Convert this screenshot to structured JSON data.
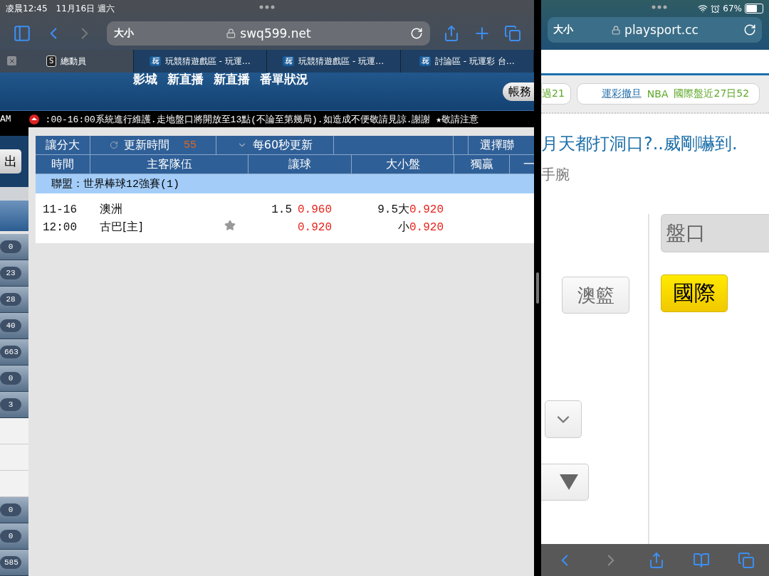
{
  "left_window": {
    "status_bar": {
      "time": "凌晨12:45",
      "date": "11月16日 週六"
    },
    "address_bar": {
      "text_size": "大小",
      "url": "swq599.net"
    },
    "tabs": [
      {
        "label": "總動員",
        "badge": "S",
        "selected": true
      },
      {
        "label": "玩競猜遊戲區 - 玩運…",
        "badge": "玩",
        "selected": false
      },
      {
        "label": "玩競猜遊戲區 - 玩運…",
        "badge": "玩",
        "selected": false
      },
      {
        "label": "討論區 - 玩運彩 台…",
        "badge": "玩",
        "selected": false
      }
    ],
    "site": {
      "nav": [
        "影城",
        "新直播",
        "新直播",
        "番單狀況"
      ],
      "account_button": "帳務",
      "ticker_prefix": "AM",
      "ticker": ":00-16:00系統進行維護.走地盤口將開放至13點(不論至第幾局).如造成不便敬請見諒.謝謝  ★敬請注意",
      "exit_button": "出",
      "sidebar": [
        {
          "kind": "badge",
          "count": "0"
        },
        {
          "kind": "badge",
          "count": "23"
        },
        {
          "kind": "badge",
          "count": "28"
        },
        {
          "kind": "badge",
          "count": "40"
        },
        {
          "kind": "badge",
          "count": "663"
        },
        {
          "kind": "badge",
          "count": "0"
        },
        {
          "kind": "badge",
          "count": "3"
        },
        {
          "kind": "blank"
        },
        {
          "kind": "blank"
        },
        {
          "kind": "blank"
        },
        {
          "kind": "badge",
          "count": "0"
        },
        {
          "kind": "badge",
          "count": "0"
        },
        {
          "kind": "badge",
          "count": "585"
        }
      ],
      "odds": {
        "toolbar": {
          "mode": "讓分大",
          "refresh_label": "更新時間",
          "countdown": "55",
          "interval": "每60秒更新",
          "league_select": "選擇聯"
        },
        "columns": [
          "時間",
          "主客隊伍",
          "讓球",
          "大小盤",
          "獨贏",
          "一"
        ],
        "league": "聯盟：世界棒球12強賽(1)",
        "matches": [
          {
            "date": "11-16",
            "time": "12:00",
            "teams": [
              "澳洲",
              "古巴[主]"
            ],
            "starred": false,
            "handicap": "1.5",
            "handicap_odds": [
              "0.960",
              "0.920"
            ],
            "totals": [
              "9.5大",
              "小"
            ],
            "totals_odds": [
              "0.920",
              "0.920"
            ]
          }
        ]
      }
    }
  },
  "right_window": {
    "status_bar": {
      "battery": "67%"
    },
    "address_bar": {
      "text_size": "大小",
      "url": "playsport.cc"
    },
    "ticker": [
      {
        "parts": [
          {
            "text": "過21",
            "kind": "green"
          }
        ]
      },
      {
        "parts": [
          {
            "text": "運彩撤旦",
            "kind": "link"
          },
          {
            "text": "NBA",
            "kind": "green"
          },
          {
            "text": "國際盤近27日52",
            "kind": "green"
          }
        ]
      }
    ],
    "headline": "月天都打洞口?..威剛嚇到.",
    "subtitle": "手腕",
    "sports": [
      {
        "label": "澳籃",
        "selected": false
      }
    ],
    "market_field": "盤口",
    "markets": [
      {
        "label": "國際",
        "selected": true
      }
    ]
  }
}
